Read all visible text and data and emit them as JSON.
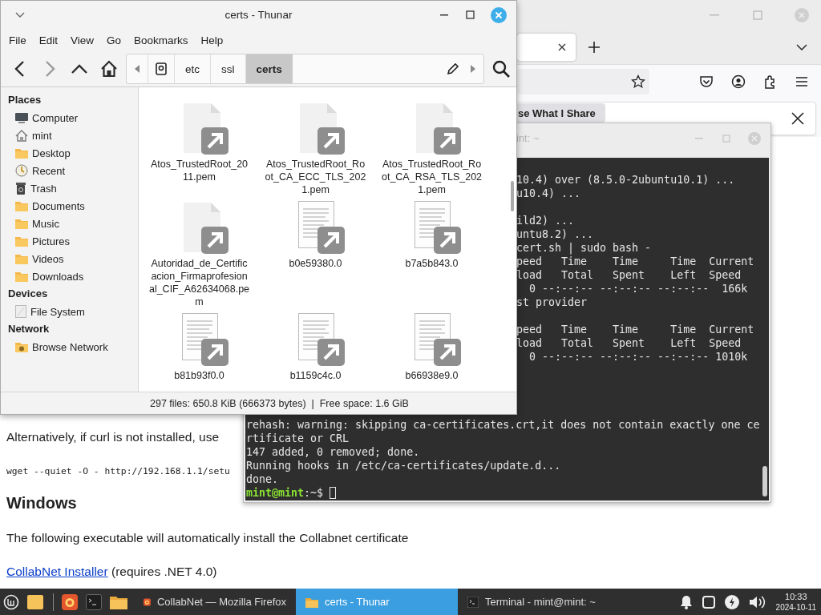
{
  "firefox": {
    "notification_button": "se What I Share",
    "page": {
      "paragraph_1": "Alternatively, if curl is not installed, use",
      "code": "wget --quiet -O - http://192.168.1.1/setu",
      "heading": "Windows",
      "paragraph_2": "The following executable will automatically install the Collabnet certificate",
      "link": "CollabNet Installer",
      "link_note": "(requires .NET 4.0)"
    }
  },
  "terminal": {
    "title": "int: ~",
    "upper_blocks": [
      [
        "10.4) over (8.5.0-2ubuntu10.1) ...",
        "u10.4) ..."
      ],
      [
        "ild2) ...",
        "untu8.2) ...",
        "cert.sh | sudo bash -",
        "peed   Time    Time     Time  Current",
        "load   Total   Spent    Left  Speed",
        "  0 --:--:-- --:--:-- --:--:--  166k",
        "st provider"
      ],
      [
        "peed   Time    Time     Time  Current",
        "load   Total   Spent    Left  Speed",
        "  0 --:--:-- --:--:-- --:--:-- 1010k"
      ]
    ],
    "lower_lines": [
      "rehash: warning: skipping ca-certificates.crt,it does not contain exactly one ce",
      "rtificate or CRL",
      "147 added, 0 removed; done.",
      "Running hooks in /etc/ca-certificates/update.d...",
      "done."
    ],
    "prompt": {
      "user": "mint@mint",
      "path": ":~$"
    }
  },
  "thunar": {
    "title": "certs - Thunar",
    "menu": [
      "File",
      "Edit",
      "View",
      "Go",
      "Bookmarks",
      "Help"
    ],
    "navigation": [
      {
        "kind": "back",
        "disabled": false
      },
      {
        "kind": "forward",
        "disabled": true
      },
      {
        "kind": "up",
        "disabled": false
      },
      {
        "kind": "home",
        "disabled": false
      }
    ],
    "path": [
      {
        "label": "etc",
        "selected": false
      },
      {
        "label": "ssl",
        "selected": false
      },
      {
        "label": "certs",
        "selected": true
      }
    ],
    "sidebar": [
      {
        "heading": "Places",
        "items": [
          {
            "label": "Computer",
            "kind": "computer"
          },
          {
            "label": "mint",
            "kind": "home"
          },
          {
            "label": "Desktop",
            "kind": "folder"
          },
          {
            "label": "Recent",
            "kind": "recent"
          },
          {
            "label": "Trash",
            "kind": "trash"
          },
          {
            "label": "Documents",
            "kind": "folder"
          },
          {
            "label": "Music",
            "kind": "folder"
          },
          {
            "label": "Pictures",
            "kind": "folder"
          },
          {
            "label": "Videos",
            "kind": "folder"
          },
          {
            "label": "Downloads",
            "kind": "folder"
          }
        ]
      },
      {
        "heading": "Devices",
        "items": [
          {
            "label": "File System",
            "kind": "drive"
          }
        ]
      },
      {
        "heading": "Network",
        "items": [
          {
            "label": "Browse Network",
            "kind": "network"
          }
        ]
      }
    ],
    "files": [
      {
        "name": "Atos_TrustedRoot_2011.pem",
        "kind": "blank"
      },
      {
        "name": "Atos_TrustedRoot_Root_CA_ECC_TLS_2021.pem",
        "kind": "blank"
      },
      {
        "name": "Atos_TrustedRoot_Root_CA_RSA_TLS_2021.pem",
        "kind": "blank"
      },
      {
        "name": "Autoridad_de_Certificacion_Firmaprofesional_CIF_A62634068.pem",
        "kind": "blank"
      },
      {
        "name": "b0e59380.0",
        "kind": "text"
      },
      {
        "name": "b7a5b843.0",
        "kind": "text"
      },
      {
        "name": "b81b93f0.0",
        "kind": "text"
      },
      {
        "name": "b1159c4c.0",
        "kind": "text"
      },
      {
        "name": "b66938e9.0",
        "kind": "text"
      }
    ],
    "status": "297 files: 650.8 KiB (666373 bytes)  |  Free space: 1.6 GiB"
  },
  "taskbar": {
    "windows": [
      {
        "label": "CollabNet — Mozilla Firefox",
        "kind": "firefox",
        "selected": false
      },
      {
        "label": "certs - Thunar",
        "kind": "folder",
        "selected": true
      },
      {
        "label": "Terminal - mint@mint: ~",
        "kind": "terminal",
        "selected": false
      }
    ],
    "clock": {
      "time": "10:33",
      "date": "2024-10-11"
    }
  }
}
